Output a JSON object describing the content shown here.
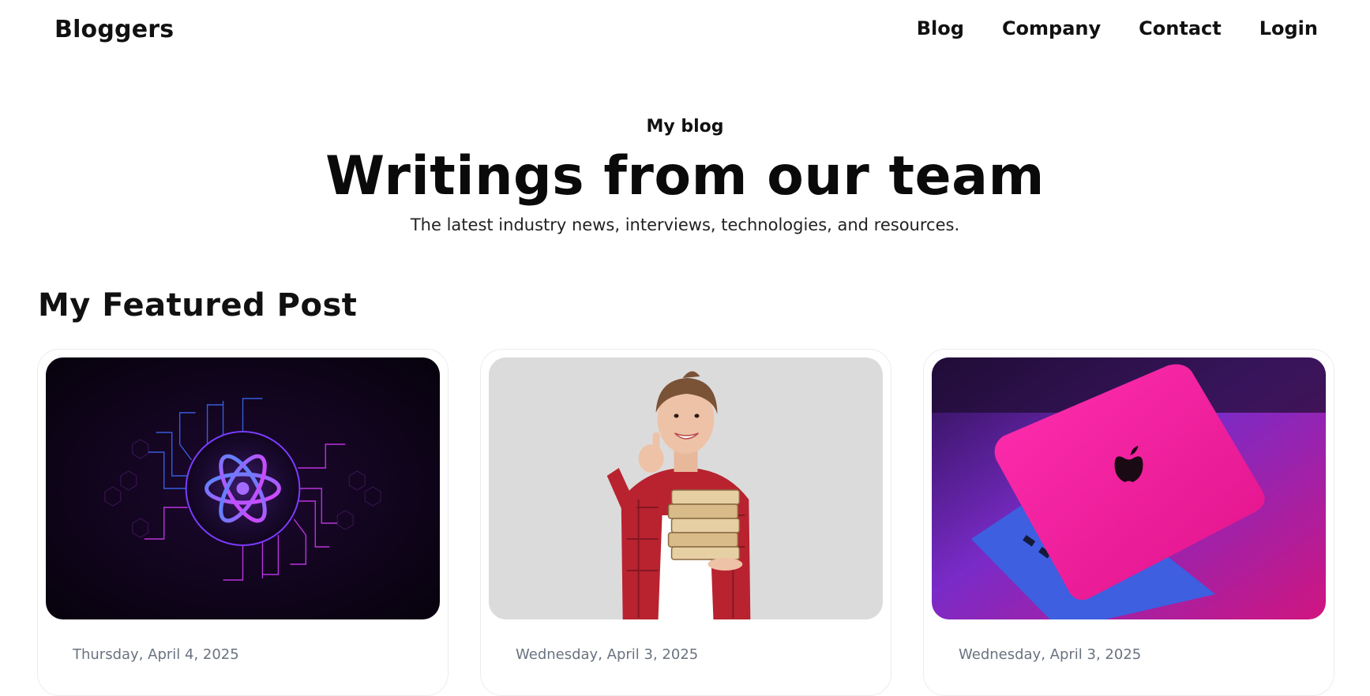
{
  "header": {
    "brand": "Bloggers",
    "nav": [
      {
        "label": "Blog"
      },
      {
        "label": "Company"
      },
      {
        "label": "Contact"
      },
      {
        "label": "Login"
      }
    ]
  },
  "hero": {
    "eyebrow": "My blog",
    "title": "Writings from our team",
    "subtitle": "The latest industry news, interviews, technologies, and resources."
  },
  "featured": {
    "heading": "My Featured Post",
    "posts": [
      {
        "date": "Thursday, April 4, 2025",
        "image": "react-atom-circuit-image"
      },
      {
        "date": "Wednesday, April 3, 2025",
        "image": "woman-holding-books-image"
      },
      {
        "date": "Wednesday, April 3, 2025",
        "image": "pink-laptop-image"
      }
    ]
  },
  "colors": {
    "text": "#111111",
    "muted": "#6b7280",
    "card_border": "#ececec"
  }
}
